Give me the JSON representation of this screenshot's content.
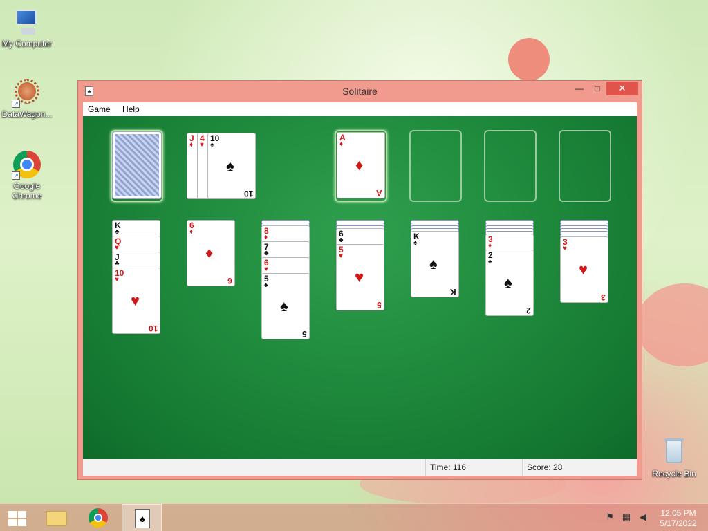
{
  "desktop": {
    "icons": [
      {
        "label": "My Computer",
        "icon": "computer-icon"
      },
      {
        "label": "DataWagon...",
        "icon": "datawagon-icon"
      },
      {
        "label": "Google Chrome",
        "icon": "chrome-icon"
      },
      {
        "label": "Recycle Bin",
        "icon": "recycle-bin-icon"
      }
    ]
  },
  "window": {
    "title": "Solitaire",
    "controls": {
      "minimize": "—",
      "maximize": "□",
      "close": "✕"
    },
    "menu": [
      "Game",
      "Help"
    ]
  },
  "game": {
    "waste_top": [
      {
        "rank": "J",
        "suit": "♦",
        "color": "red"
      },
      {
        "rank": "4",
        "suit": "♥",
        "color": "red"
      },
      {
        "rank": "10",
        "suit": "♠",
        "color": "black"
      }
    ],
    "foundations": [
      {
        "rank": "A",
        "suit": "♦",
        "color": "red"
      },
      null,
      null,
      null
    ],
    "tableau": [
      {
        "hidden": 0,
        "cards": [
          {
            "rank": "K",
            "suit": "♣",
            "color": "black"
          },
          {
            "rank": "Q",
            "suit": "♥",
            "color": "red"
          },
          {
            "rank": "J",
            "suit": "♣",
            "color": "black"
          },
          {
            "rank": "10",
            "suit": "♥",
            "color": "red"
          }
        ]
      },
      {
        "hidden": 0,
        "cards": [
          {
            "rank": "6",
            "suit": "♦",
            "color": "red"
          }
        ]
      },
      {
        "hidden": 2,
        "cards": [
          {
            "rank": "8",
            "suit": "♦",
            "color": "red"
          },
          {
            "rank": "7",
            "suit": "♣",
            "color": "black"
          },
          {
            "rank": "6",
            "suit": "♥",
            "color": "red"
          },
          {
            "rank": "5",
            "suit": "♠",
            "color": "black"
          }
        ]
      },
      {
        "hidden": 3,
        "cards": [
          {
            "rank": "6",
            "suit": "♣",
            "color": "black"
          },
          {
            "rank": "5",
            "suit": "♥",
            "color": "red"
          }
        ]
      },
      {
        "hidden": 4,
        "cards": [
          {
            "rank": "K",
            "suit": "♠",
            "color": "black"
          }
        ]
      },
      {
        "hidden": 5,
        "cards": [
          {
            "rank": "3",
            "suit": "♦",
            "color": "red"
          },
          {
            "rank": "2",
            "suit": "♠",
            "color": "black"
          }
        ]
      },
      {
        "hidden": 6,
        "cards": [
          {
            "rank": "3",
            "suit": "♥",
            "color": "red"
          }
        ]
      }
    ]
  },
  "status": {
    "time_label": "Time:",
    "time_value": "116",
    "score_label": "Score:",
    "score_value": "28"
  },
  "taskbar": {
    "apps": [
      "start-icon",
      "file-explorer-icon",
      "chrome-icon",
      "solitaire-icon"
    ],
    "clock_time": "12:05 PM",
    "clock_date": "5/17/2022"
  },
  "colors": {
    "felt": "#1f8a3c",
    "window_frame": "#f19a8e",
    "close_button": "#e0544b"
  }
}
